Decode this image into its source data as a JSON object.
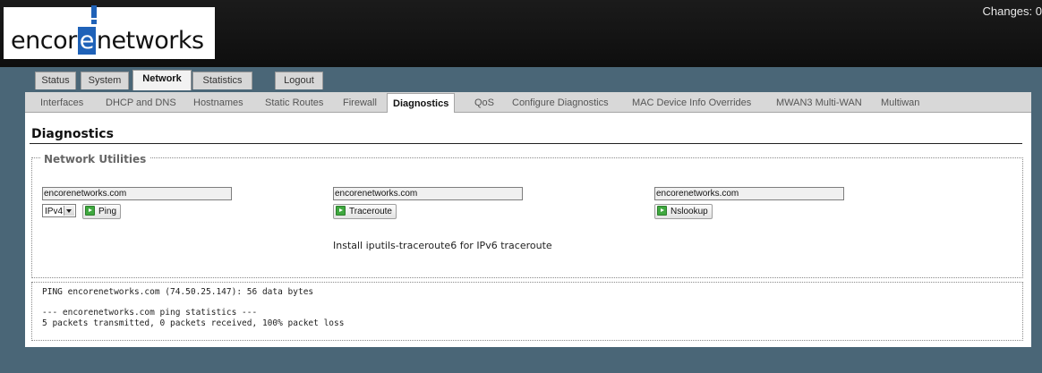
{
  "header": {
    "logo_prefix": "encor",
    "logo_e": "e",
    "logo_suffix": "networks",
    "changes_label": "Changes: 0"
  },
  "top_tabs": [
    {
      "label": "Status"
    },
    {
      "label": "System"
    },
    {
      "label": "Network",
      "active": true
    },
    {
      "label": "Statistics"
    },
    {
      "label": "Logout"
    }
  ],
  "sub_tabs": [
    {
      "label": "Interfaces"
    },
    {
      "label": "DHCP and DNS"
    },
    {
      "label": "Hostnames"
    },
    {
      "label": "Static Routes"
    },
    {
      "label": "Firewall"
    },
    {
      "label": "Diagnostics",
      "active": true
    },
    {
      "label": "QoS"
    },
    {
      "label": "Configure Diagnostics"
    },
    {
      "label": "MAC Device Info Overrides"
    },
    {
      "label": "MWAN3 Multi-WAN"
    },
    {
      "label": "Multiwan"
    }
  ],
  "page": {
    "title": "Diagnostics",
    "section_legend": "Network Utilities",
    "ping": {
      "host_value": "encorenetworks.com",
      "protocol_selected": "IPv4",
      "button_label": "Ping"
    },
    "traceroute": {
      "host_value": "encorenetworks.com",
      "button_label": "Traceroute",
      "note": "Install iputils-traceroute6 for IPv6 traceroute"
    },
    "nslookup": {
      "host_value": "encorenetworks.com",
      "button_label": "Nslookup"
    },
    "output_lines": [
      "PING encorenetworks.com (74.50.25.147): 56 data bytes",
      "",
      "--- encorenetworks.com ping statistics ---",
      "5 packets transmitted, 0 packets received, 100% packet loss"
    ]
  },
  "colors": {
    "background": "#4a6677",
    "header": "#111111",
    "logo_accent": "#1f62b8",
    "button_icon": "#3fa83f"
  },
  "icons": {
    "button_icon": "play-icon",
    "select_arrow": "chevron-down-icon"
  }
}
